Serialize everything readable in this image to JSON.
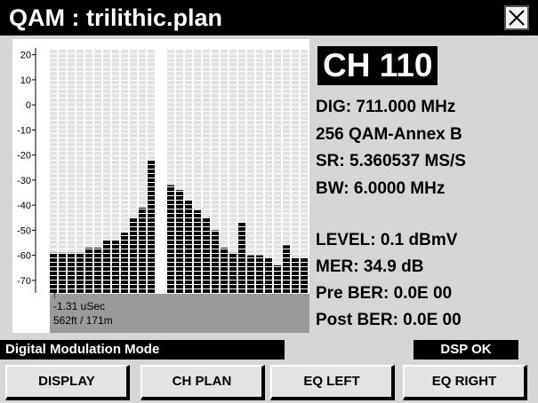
{
  "window": {
    "title": "QAM : trilithic.plan"
  },
  "channel": {
    "label": "CH 110",
    "dig": "DIG: 711.000 MHz",
    "modulation": "256 QAM-Annex B",
    "sr": "SR: 5.360537 MS/S",
    "bw": "BW: 6.0000 MHz",
    "level": "LEVEL:  0.1 dBmV",
    "mer": "MER: 34.9 dB",
    "pre_ber": "Pre BER: 0.0E 00",
    "post_ber": "Post BER: 0.0E 00"
  },
  "chart": {
    "marker_glyph": "↑",
    "delay": "-1.31 uSec",
    "distance": "562ft / 171m"
  },
  "chart_data": {
    "type": "bar",
    "ylim": [
      -75,
      22
    ],
    "yticks": [
      "20",
      "10",
      "0",
      "-10",
      "-20",
      "-30",
      "-40",
      "-50",
      "-60",
      "-70"
    ],
    "ytick_values": [
      20,
      10,
      0,
      -10,
      -20,
      -30,
      -40,
      -50,
      -60,
      -70
    ],
    "baseline": -75,
    "values": [
      -59,
      -59,
      -59,
      -59,
      -57,
      -57,
      -54,
      -54,
      -51,
      -45,
      -41,
      -22,
      -32,
      -34,
      -38,
      -42,
      -45,
      -50,
      -57,
      -59,
      -47,
      -60,
      -60,
      -61,
      -64,
      -56,
      -61,
      -61
    ]
  },
  "status": {
    "mode": "Digital Modulation Mode",
    "dsp": "DSP OK"
  },
  "softkeys": {
    "display": "DISPLAY",
    "ch_plan": "CH PLAN",
    "eq_left": "EQ LEFT",
    "eq_right": "EQ RIGHT"
  }
}
